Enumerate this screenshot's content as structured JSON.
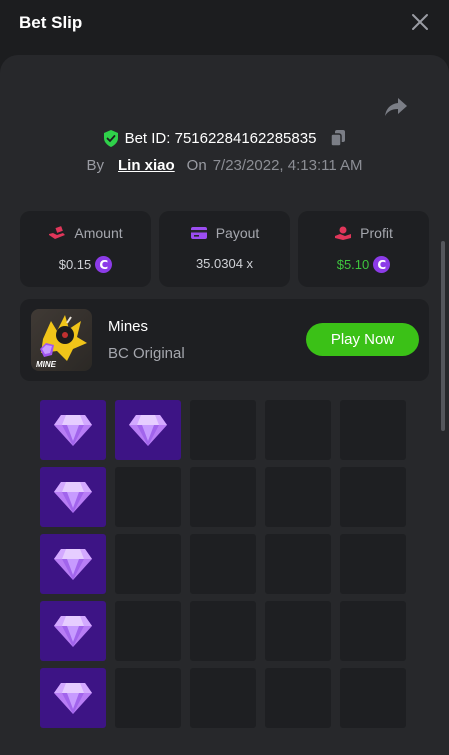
{
  "header": {
    "title": "Bet Slip"
  },
  "bet": {
    "id_label": "Bet ID: 75162284162285835",
    "by_label": "By",
    "user": "Lin xiao",
    "on_label": "On",
    "date": "7/23/2022, 4:13:11 AM"
  },
  "stats": [
    {
      "label": "Amount",
      "value": "$0.15"
    },
    {
      "label": "Payout",
      "value": "35.0304 x"
    },
    {
      "label": "Profit",
      "value": "$5.10"
    }
  ],
  "coin_symbol": "C",
  "game": {
    "name": "Mines",
    "sub": "BC Original",
    "thumb_label": "MINE",
    "play_label": "Play Now"
  },
  "grid": {
    "columns": 5,
    "rows": [
      [
        "gem",
        "gem",
        "empty",
        "empty",
        "empty"
      ],
      [
        "gem",
        "empty",
        "empty",
        "empty",
        "empty"
      ],
      [
        "gem",
        "empty",
        "empty",
        "empty",
        "empty"
      ],
      [
        "gem",
        "empty",
        "empty",
        "empty",
        "empty"
      ],
      [
        "gem",
        "empty",
        "empty",
        "empty",
        "empty"
      ]
    ]
  },
  "colors": {
    "accent_green": "#3bc117",
    "profit_green": "#3ec53e",
    "gem_tile": "#3d1485",
    "coin_purple": "#8c3be8",
    "verified_green": "#2fd14a"
  },
  "icons": {
    "close": "close-icon",
    "share": "share-icon",
    "verified": "shield-check-icon",
    "copy": "copy-icon",
    "amount": "hand-money-icon",
    "payout": "wallet-icon",
    "profit": "profit-hand-icon",
    "gem": "diamond-icon"
  }
}
